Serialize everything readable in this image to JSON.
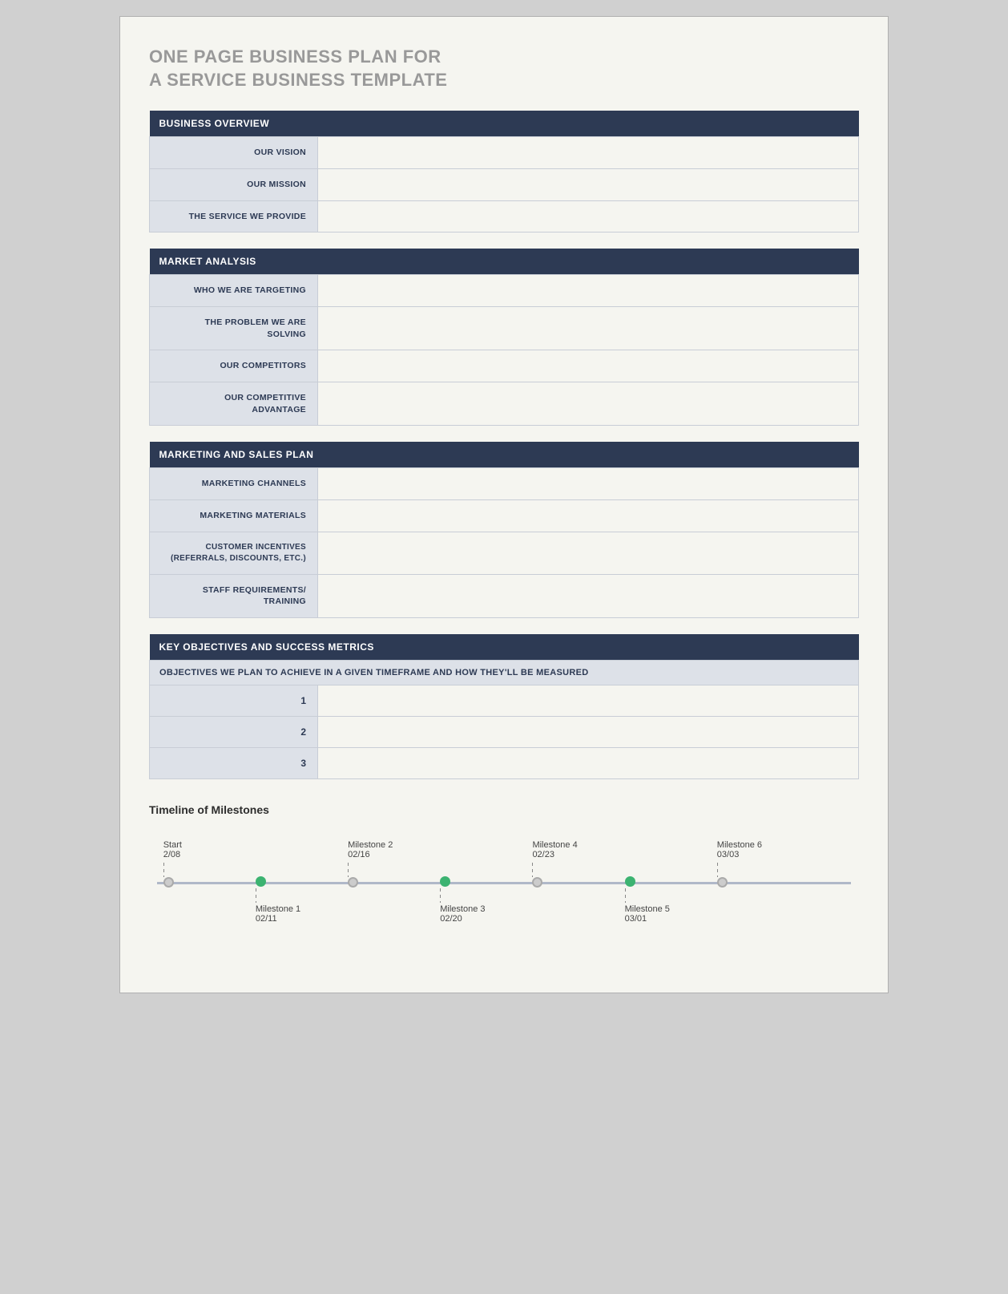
{
  "page": {
    "title_line1": "ONE PAGE BUSINESS PLAN FOR",
    "title_line2": "A SERVICE BUSINESS TEMPLATE"
  },
  "business_overview": {
    "header": "BUSINESS OVERVIEW",
    "rows": [
      {
        "label": "OUR VISION",
        "value": ""
      },
      {
        "label": "OUR MISSION",
        "value": ""
      },
      {
        "label": "THE SERVICE WE PROVIDE",
        "value": ""
      }
    ]
  },
  "market_analysis": {
    "header": "MARKET ANALYSIS",
    "rows": [
      {
        "label": "WHO WE ARE TARGETING",
        "value": ""
      },
      {
        "label": "THE PROBLEM WE ARE SOLVING",
        "value": ""
      },
      {
        "label": "OUR COMPETITORS",
        "value": ""
      },
      {
        "label": "OUR COMPETITIVE ADVANTAGE",
        "value": ""
      }
    ]
  },
  "marketing_sales": {
    "header": "MARKETING AND SALES PLAN",
    "rows": [
      {
        "label": "MARKETING CHANNELS",
        "value": ""
      },
      {
        "label": "MARKETING MATERIALS",
        "value": ""
      },
      {
        "label": "CUSTOMER INCENTIVES\n(REFERRALS, DISCOUNTS, ETC.)",
        "value": ""
      },
      {
        "label": "STAFF REQUIREMENTS/\nTRAINING",
        "value": ""
      }
    ]
  },
  "key_objectives": {
    "header": "KEY OBJECTIVES AND SUCCESS METRICS",
    "subheader": "OBJECTIVES WE PLAN TO ACHIEVE IN A GIVEN TIMEFRAME AND HOW THEY'LL BE MEASURED",
    "rows": [
      {
        "number": "1",
        "value": ""
      },
      {
        "number": "2",
        "value": ""
      },
      {
        "number": "3",
        "value": ""
      }
    ]
  },
  "timeline": {
    "title": "Timeline of Milestones",
    "milestones_top": [
      {
        "label": "Start",
        "date": "2/08",
        "left_pct": 2,
        "dot_type": "gray"
      },
      {
        "label": "Milestone 2",
        "date": "02/16",
        "left_pct": 28,
        "dot_type": "gray"
      },
      {
        "label": "Milestone 4",
        "date": "02/23",
        "left_pct": 54,
        "dot_type": "gray"
      },
      {
        "label": "Milestone 6",
        "date": "03/03",
        "left_pct": 80,
        "dot_type": "gray"
      }
    ],
    "milestones_bottom": [
      {
        "label": "Milestone 1",
        "date": "02/11",
        "left_pct": 15,
        "dot_type": "green"
      },
      {
        "label": "Milestone 3",
        "date": "02/20",
        "left_pct": 41,
        "dot_type": "green"
      },
      {
        "label": "Milestone 5",
        "date": "03/01",
        "left_pct": 67,
        "dot_type": "green"
      }
    ]
  }
}
